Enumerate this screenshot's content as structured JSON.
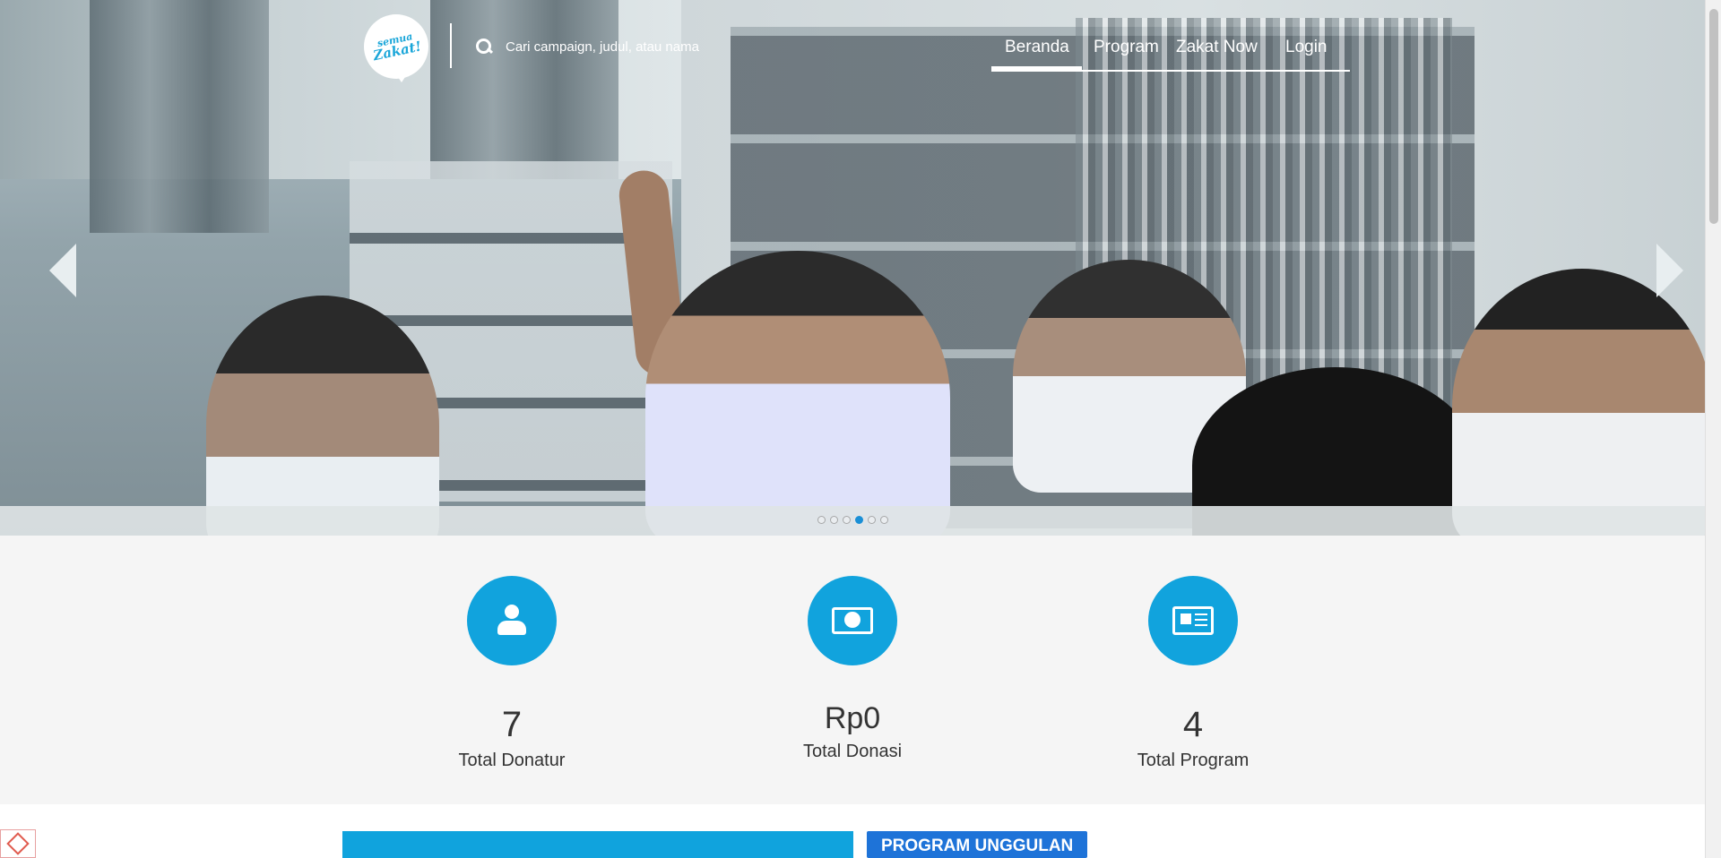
{
  "header": {
    "logo_text_1": "semua",
    "logo_text_2": "Zakat!",
    "search_placeholder": "Cari campaign, judul, atau nama",
    "nav": [
      "Beranda",
      "Program",
      "Zakat Now",
      "Login"
    ],
    "active_nav": "Beranda"
  },
  "carousel": {
    "slide_count": 6,
    "active_index": 3
  },
  "stats": [
    {
      "value": "7",
      "label": "Total Donatur",
      "icon": "user-icon"
    },
    {
      "value": "Rp0",
      "label": "Total Donasi",
      "icon": "money-icon"
    },
    {
      "value": "4",
      "label": "Total Program",
      "icon": "newspaper-icon"
    }
  ],
  "section": {
    "program_label": "PROGRAM UNGGULAN"
  },
  "colors": {
    "accent": "#11a3dd",
    "label_blue": "#1e73d8",
    "background": "#f5f5f5"
  }
}
